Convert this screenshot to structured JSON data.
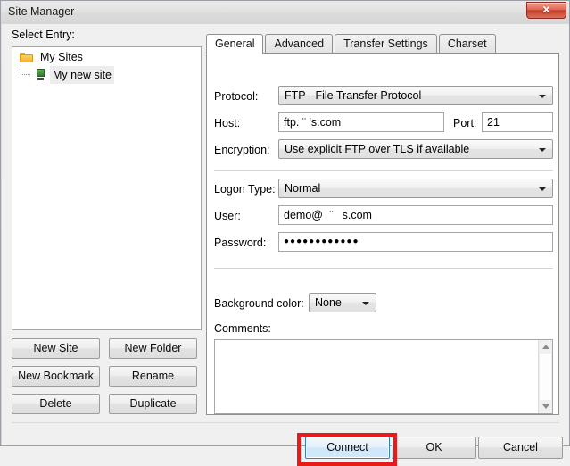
{
  "window": {
    "title": "Site Manager",
    "close_label": "✕"
  },
  "left_pane": {
    "select_entry_label": "Select Entry:",
    "tree": {
      "root": {
        "label": "My Sites",
        "icon": "folder-icon"
      },
      "children": [
        {
          "label": "My new site",
          "icon": "server-icon",
          "selected": true
        }
      ]
    },
    "buttons": [
      {
        "id": "new-site",
        "label": "New Site"
      },
      {
        "id": "new-folder",
        "label": "New Folder"
      },
      {
        "id": "new-bookmark",
        "label": "New Bookmark"
      },
      {
        "id": "rename",
        "label": "Rename"
      },
      {
        "id": "delete",
        "label": "Delete"
      },
      {
        "id": "duplicate",
        "label": "Duplicate"
      }
    ]
  },
  "tabs": [
    {
      "id": "general",
      "label": "General",
      "active": true
    },
    {
      "id": "advanced",
      "label": "Advanced",
      "active": false
    },
    {
      "id": "transfer-settings",
      "label": "Transfer Settings",
      "active": false
    },
    {
      "id": "charset",
      "label": "Charset",
      "active": false
    }
  ],
  "general": {
    "protocol_label": "Protocol:",
    "protocol_value": "FTP - File Transfer Protocol",
    "host_label": "Host:",
    "host_value": "ftp.      ¨      's.com",
    "port_label": "Port:",
    "port_value": "21",
    "encryption_label": "Encryption:",
    "encryption_value": "Use explicit FTP over TLS if available",
    "logon_type_label": "Logon Type:",
    "logon_type_value": "Normal",
    "user_label": "User:",
    "user_value": "demo@   ¨    s.com",
    "password_label": "Password:",
    "password_value": "●●●●●●●●●●●●",
    "background_color_label": "Background color:",
    "background_color_value": "None",
    "comments_label": "Comments:",
    "comments_value": ""
  },
  "footer": {
    "connect_label": "Connect",
    "ok_label": "OK",
    "cancel_label": "Cancel"
  },
  "annotation": {
    "color": "#e81a1a",
    "target": "connect-button"
  }
}
